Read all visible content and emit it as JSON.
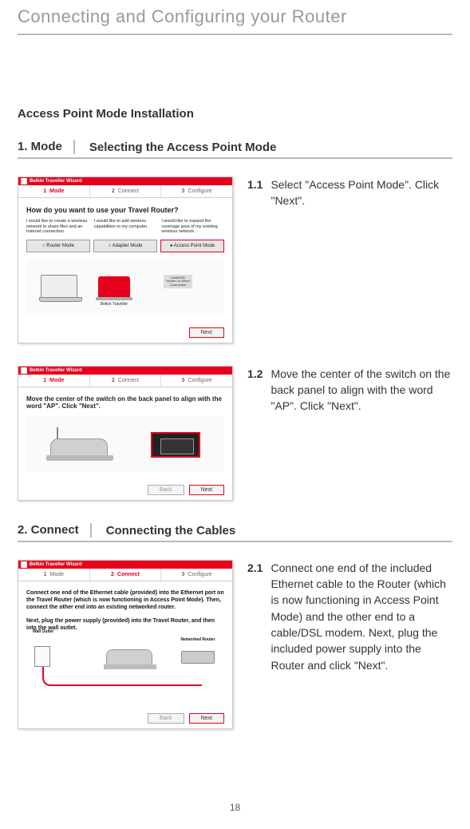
{
  "pageHeader": "Connecting and Configuring your Router",
  "section1Title": "Access Point Mode Installation",
  "step1": {
    "num": "1. Mode",
    "label": "Selecting the Access Point Mode"
  },
  "step2": {
    "num": "2. Connect",
    "label": "Connecting the Cables"
  },
  "instr11": {
    "num": "1.1",
    "text": "Select \"Access Point Mode\". Click \"Next\"."
  },
  "instr12": {
    "num": "1.2",
    "text": "Move the center of the switch on the back panel to align with the word \"AP\". Click \"Next\"."
  },
  "instr21": {
    "num": "2.1",
    "text": "Connect one end of the included Ethernet cable to the Router (which is now functioning in Access Point Mode) and the other end to a cable/DSL modem. Next, plug the included power supply into the Router and click \"Next\"."
  },
  "wizard": {
    "title": "Belkin Traveller Wizard",
    "tabs": {
      "t1n": "1",
      "t1": "Mode",
      "t2n": "2",
      "t2": "Connect",
      "t3n": "3",
      "t3": "Configure"
    },
    "q1": "How do you want to use your Travel Router?",
    "desc": {
      "a": "I would like to create a wireless network to share files and an Internet connection.",
      "b": "I would like to add wireless capabilities to my computer.",
      "c": "I would like to expand the coverage area of my existing wireless network."
    },
    "modeButtons": {
      "a": "Router Mode",
      "b": "Adapter Mode",
      "c": "Access Point Mode"
    },
    "routerLabel": "Belkin Traveller",
    "lanLabel": "Cable/DSL Modem or Wired Connection",
    "back": "Back",
    "next": "Next",
    "q2": "Move the center of the switch on the back panel to align with the word \"AP\". Click \"Next\".",
    "body3a": "Connect one end of the Ethernet cable (provided) into the Ethernet port on the Travel Router (which is now functioning in Access Point Mode). Then, connect the other end into an existing networked router.",
    "body3b": "Next, plug the power supply (provided) into the Travel Router, and then into the wall outlet.",
    "wallLabel": "Wall Outlet",
    "netLabel": "Networked Router"
  },
  "pageNumber": "18"
}
